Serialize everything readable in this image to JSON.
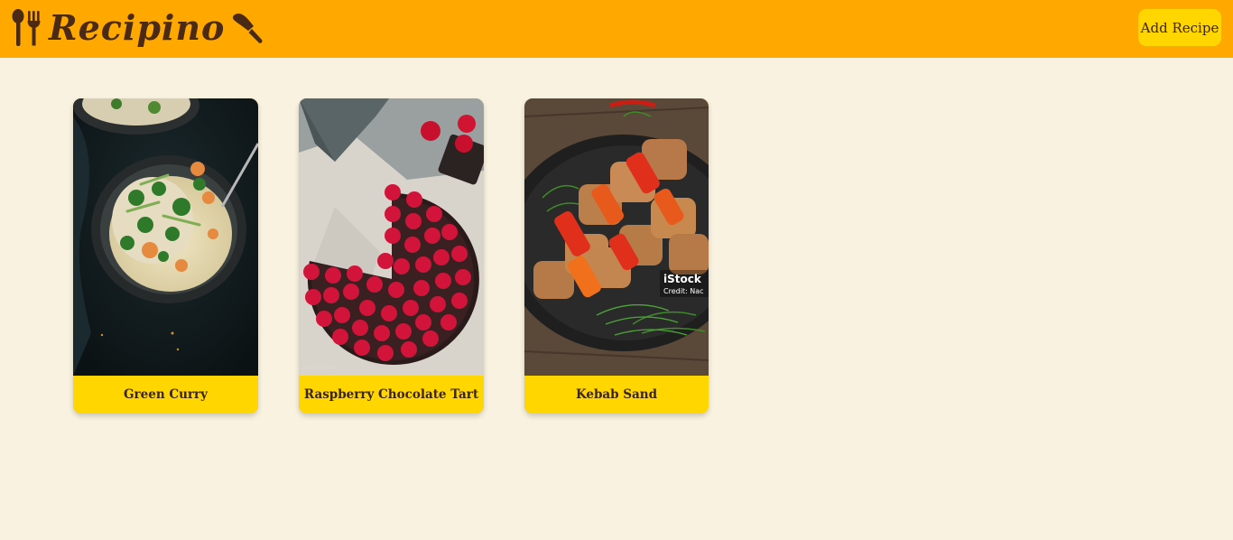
{
  "app": {
    "title": "Recipino"
  },
  "header": {
    "add_button_label": "Add Recipe"
  },
  "recipes": [
    {
      "name": "Green Curry"
    },
    {
      "name": "Raspberry Chocolate Tart"
    },
    {
      "name": "Kebab Sand",
      "image_overlay": {
        "brand": "iStock",
        "credit": "Credit: Nac"
      }
    }
  ],
  "colors": {
    "header": "#ffa800",
    "button": "#ffd600",
    "background": "#faf2e0",
    "text": "#3b2414"
  }
}
